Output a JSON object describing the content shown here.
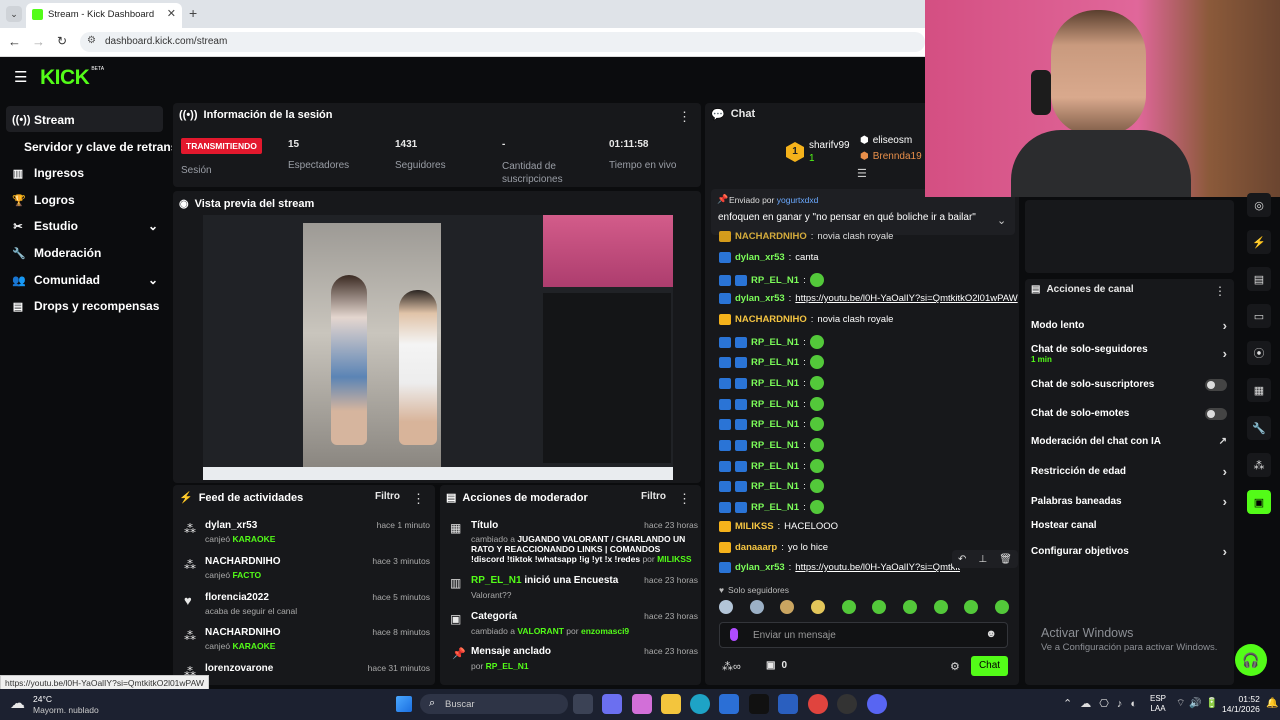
{
  "browser": {
    "tab_title": "Stream - Kick Dashboard",
    "url": "dashboard.kick.com/stream",
    "status_url": "https://youtu.be/l0H-YaOalIY?si=QmtkitkO2l01wPAW"
  },
  "brand": {
    "logo": "KICK",
    "beta": "BETA",
    "accent": "#53fc18"
  },
  "sidebar": {
    "items": [
      {
        "label": "Stream",
        "icon": "broadcast-icon"
      },
      {
        "label": "Servidor y clave de retransm"
      },
      {
        "label": "Ingresos",
        "icon": "chart-icon"
      },
      {
        "label": "Logros",
        "icon": "trophy-icon"
      },
      {
        "label": "Estudio",
        "icon": "tools-icon"
      },
      {
        "label": "Moderación",
        "icon": "wrench-icon"
      },
      {
        "label": "Comunidad",
        "icon": "people-icon"
      },
      {
        "label": "Drops y recompensas",
        "icon": "drops-icon"
      }
    ]
  },
  "session": {
    "title": "Información de la sesión",
    "status": "TRANSMITIENDO",
    "status_label": "Sesión",
    "stats": [
      {
        "value": "15",
        "label": "Espectadores"
      },
      {
        "value": "1431",
        "label": "Seguidores"
      },
      {
        "value": "-",
        "label": "Cantidad de suscripciones"
      },
      {
        "value": "01:11:58",
        "label": "Tiempo en vivo"
      }
    ]
  },
  "preview": {
    "title": "Vista previa del stream"
  },
  "feed": {
    "title": "Feed de actividades",
    "filter": "Filtro",
    "items": [
      {
        "name": "dylan_xr53",
        "action": "canjeó",
        "reward": "KARAOKE",
        "time": "hace 1 minuto"
      },
      {
        "name": "NACHARDNIHO",
        "action": "canjeó",
        "reward": "FACTO",
        "time": "hace 3 minutos"
      },
      {
        "name": "florencia2022",
        "action": "acaba de seguir el canal",
        "reward": "",
        "time": "hace 5 minutos"
      },
      {
        "name": "NACHARDNIHO",
        "action": "canjeó",
        "reward": "KARAOKE",
        "time": "hace 8 minutos"
      },
      {
        "name": "lorenzovarone",
        "action": "",
        "reward": "",
        "time": "hace 31 minutos"
      }
    ]
  },
  "modactions": {
    "title": "Acciones de moderador",
    "filter": "Filtro",
    "items": [
      {
        "title": "Título",
        "time": "hace 23 horas",
        "detail_pre": "cambiado a",
        "detail": "JUGANDO VALORANT / CHARLANDO UN RATO Y REACCIONANDO LINKS | COMANDOS !discord !tiktok !whatsapp !ig !yt !x !redes",
        "by": "por",
        "who": "MILIKSS"
      },
      {
        "title_user": "RP_EL_N1",
        "title": "inició una Encuesta",
        "time": "hace 23 horas",
        "detail": "Valorant??"
      },
      {
        "title": "Categoría",
        "time": "hace 23 horas",
        "detail_pre": "cambiado a",
        "detail": "VALORANT",
        "by": "por",
        "who": "enzomasci9"
      },
      {
        "title": "Mensaje anclado",
        "time": "hace 23 horas",
        "by": "por",
        "who": "RP_EL_N1"
      }
    ]
  },
  "chat": {
    "title": "Chat",
    "top": [
      {
        "rank": "1",
        "name": "sharifv99",
        "count": "1"
      },
      {
        "name": "eliseosm"
      },
      {
        "name": "Brennda19"
      }
    ],
    "pinned": {
      "label": "Enviado por",
      "user": "yogurtxdxd",
      "text": "enfoquen en ganar y \"no pensar en qué boliche ir a bailar\""
    },
    "messages": [
      {
        "user": "NACHARDNIHO",
        "text": "novia clash royale",
        "color": "#f5c542"
      },
      {
        "user": "dylan_xr53",
        "text": "canta",
        "color": "#7cfc5a"
      },
      {
        "user": "RP_EL_N1",
        "text": "",
        "emote": true,
        "color": "#7cfc5a"
      },
      {
        "user": "dylan_xr53",
        "text": "https://youtu.be/l0H-YaOalIY?si=QmtkitkO2l01wPAW",
        "link": true,
        "color": "#7cfc5a"
      },
      {
        "user": "NACHARDNIHO",
        "text": "novia clash royale",
        "color": "#f5c542"
      },
      {
        "user": "RP_EL_N1",
        "text": "",
        "emote": true,
        "color": "#7cfc5a"
      },
      {
        "user": "RP_EL_N1",
        "text": "",
        "emote": true,
        "color": "#7cfc5a"
      },
      {
        "user": "RP_EL_N1",
        "text": "",
        "emote": true,
        "color": "#7cfc5a"
      },
      {
        "user": "RP_EL_N1",
        "text": "",
        "emote": true,
        "color": "#7cfc5a"
      },
      {
        "user": "RP_EL_N1",
        "text": "",
        "emote": true,
        "color": "#7cfc5a"
      },
      {
        "user": "RP_EL_N1",
        "text": "",
        "emote": true,
        "color": "#7cfc5a"
      },
      {
        "user": "RP_EL_N1",
        "text": "",
        "emote": true,
        "color": "#7cfc5a"
      },
      {
        "user": "RP_EL_N1",
        "text": "",
        "emote": true,
        "color": "#7cfc5a"
      },
      {
        "user": "RP_EL_N1",
        "text": "",
        "emote": true,
        "color": "#7cfc5a"
      },
      {
        "user": "MILIKSS",
        "text": "HACELOOO",
        "color": "#f5c542"
      },
      {
        "user": "danaaarp",
        "text": "yo lo hice",
        "color": "#f5c542"
      },
      {
        "user": "dylan_xr53",
        "text": "https://youtu.be/l0H-YaOalIY?si=QmtkitkO2l01wPAW",
        "link": true,
        "color": "#7cfc5a"
      }
    ],
    "followers_only": "Solo seguidores",
    "input_placeholder": "Enviar un mensaje",
    "points": "0",
    "send": "Chat"
  },
  "channel_actions": {
    "title": "Acciones de canal",
    "items": [
      {
        "label": "Modo lento",
        "control": "chevron"
      },
      {
        "label": "Chat de solo-seguidores",
        "sub": "1 min",
        "control": "chevron"
      },
      {
        "label": "Chat de solo-suscriptores",
        "control": "toggle"
      },
      {
        "label": "Chat de solo-emotes",
        "control": "toggle"
      },
      {
        "label": "Moderación del chat con IA",
        "control": "external"
      },
      {
        "label": "Restricción de edad",
        "control": "chevron"
      },
      {
        "label": "Palabras baneadas",
        "control": "chevron"
      },
      {
        "label": "Hostear canal",
        "control": "none"
      },
      {
        "label": "Configurar objetivos",
        "control": "chevron"
      }
    ]
  },
  "windows_watermark": {
    "title": "Activar Windows",
    "sub": "Ve a Configuración para activar Windows."
  },
  "taskbar": {
    "weather_temp": "24°C",
    "weather_desc": "Mayorm. nublado",
    "search": "Buscar",
    "lang": "ESP",
    "lang2": "LAA",
    "time": "01:52",
    "date": "14/1/2026"
  }
}
